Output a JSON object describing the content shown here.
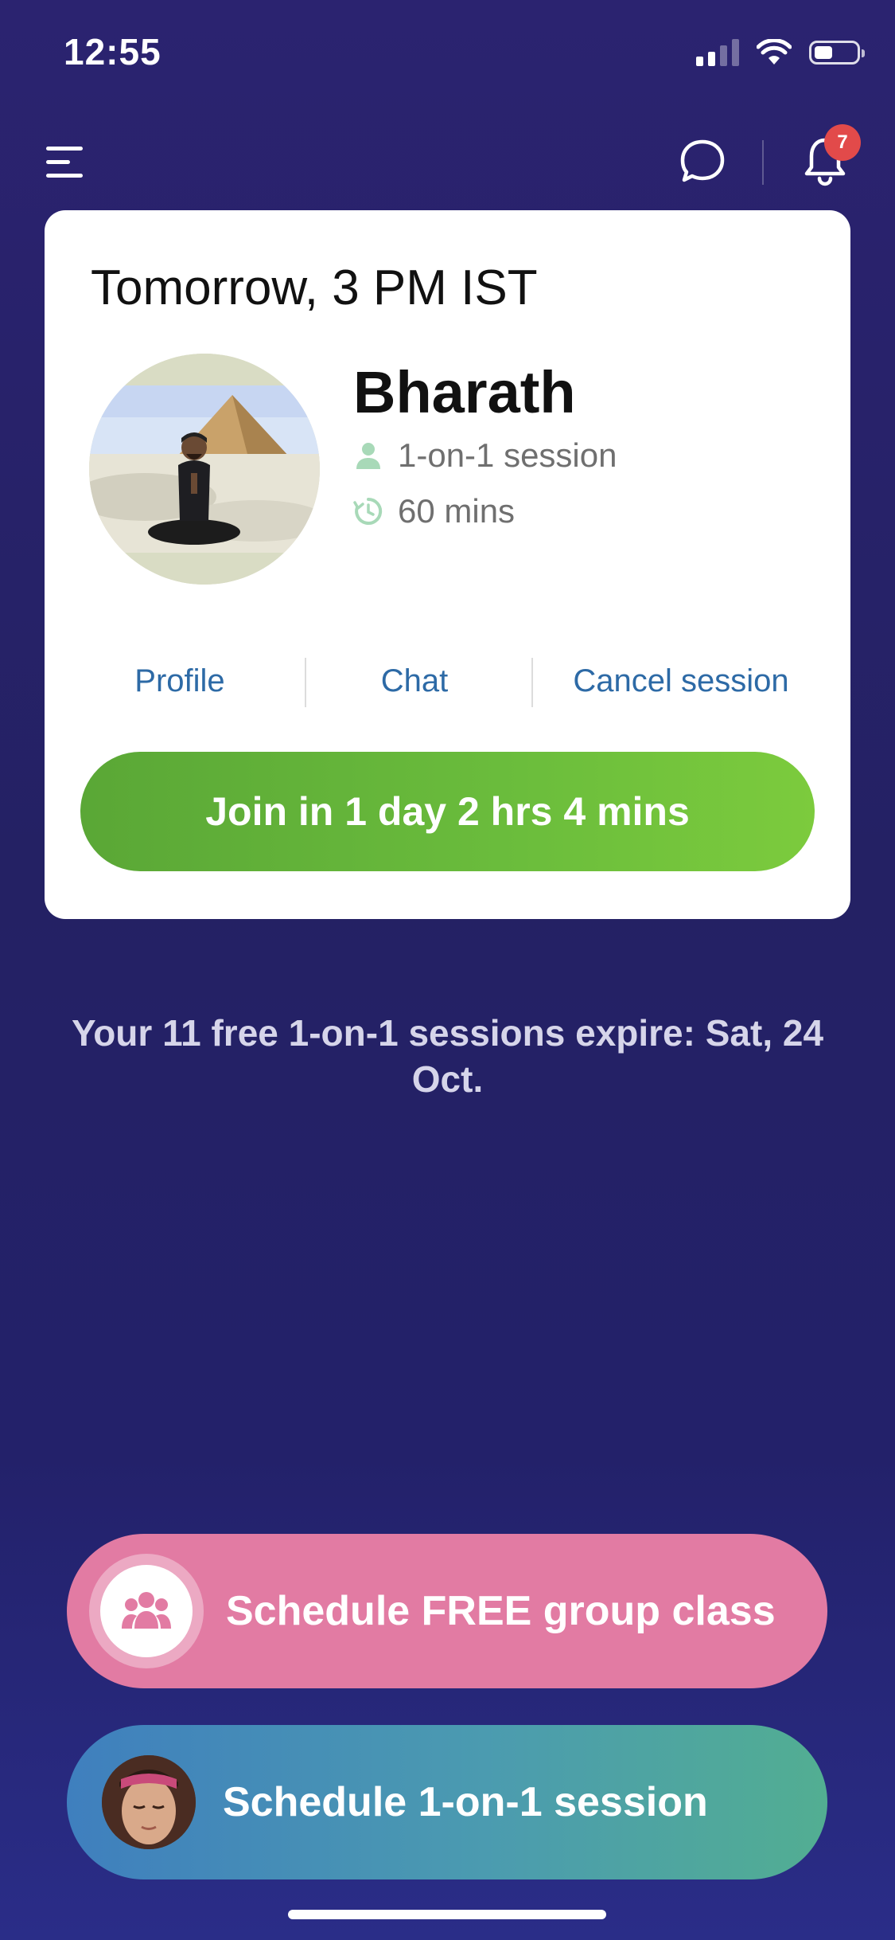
{
  "status_bar": {
    "time": "12:55"
  },
  "nav": {
    "menu_icon": "menu-icon",
    "chat_icon": "chat-icon",
    "bell_icon": "bell-icon",
    "notification_count": "7"
  },
  "session_card": {
    "time_label": "Tomorrow, 3 PM IST",
    "coach_name": "Bharath",
    "session_type": "1-on-1 session",
    "duration": "60 mins",
    "actions": {
      "profile": "Profile",
      "chat": "Chat",
      "cancel": "Cancel session"
    },
    "join_label": "Join in 1 day 2 hrs 4 mins"
  },
  "expiry_notice": "Your 11 free 1-on-1 sessions expire: Sat, 24 Oct.",
  "bottom_actions": {
    "group_class_label": "Schedule FREE group class",
    "one_on_one_label": "Schedule 1-on-1 session"
  },
  "colors": {
    "background": "#262268",
    "join_green": "#6bbd3c",
    "group_pink": "#e27ba3",
    "link_blue": "#2d6aa6",
    "badge_red": "#e24a4a"
  }
}
